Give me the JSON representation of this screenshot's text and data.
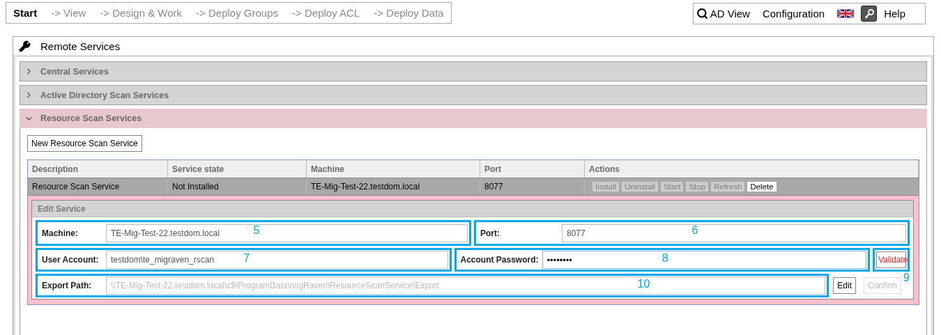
{
  "nav": {
    "steps": [
      {
        "label": "Start",
        "selected": true
      },
      {
        "label": "-> View",
        "selected": false
      },
      {
        "label": "-> Design & Work",
        "selected": false
      },
      {
        "label": "-> Deploy Groups",
        "selected": false
      },
      {
        "label": "-> Deploy ACL",
        "selected": false
      },
      {
        "label": "-> Deploy Data",
        "selected": false
      }
    ],
    "menu": [
      {
        "kind": "search-link",
        "label": "AD View"
      },
      {
        "kind": "link",
        "label": "Configuration"
      },
      {
        "kind": "flag"
      },
      {
        "kind": "key"
      },
      {
        "kind": "link",
        "label": "Help"
      }
    ]
  },
  "panel": {
    "title": "Remote Services",
    "sections": [
      {
        "title": "Central Services",
        "expanded": false
      },
      {
        "title": "Active Directory Scan Services",
        "expanded": false
      },
      {
        "title": "Resource Scan Services",
        "expanded": true
      }
    ],
    "new_button": "New Resource Scan Service",
    "table": {
      "columns": [
        "Description",
        "Service state",
        "Machine",
        "Port",
        "Actions"
      ],
      "rows": [
        {
          "selected": true,
          "cells": [
            "Resource Scan Service",
            "Not Installed",
            "TE-Mig-Test-22.testdom.local",
            "8077"
          ],
          "actions": [
            {
              "label": "Install",
              "disabled": true
            },
            {
              "label": "Uninstall",
              "disabled": true
            },
            {
              "label": "Start",
              "disabled": true
            },
            {
              "label": "Stop",
              "disabled": true
            },
            {
              "label": "Refresh",
              "disabled": true
            },
            {
              "label": "Delete",
              "disabled": false
            }
          ]
        }
      ]
    },
    "edit_service": {
      "title": "Edit Service",
      "rows": [
        {
          "fields": [
            {
              "label": "Machine:",
              "value": "TE-Mig-Test-22.testdom.local",
              "disabled": false,
              "annotation": "5"
            },
            {
              "label": "Port:",
              "value": "8077",
              "disabled": false,
              "annotation": "6"
            }
          ]
        },
        {
          "fields": [
            {
              "label": "User Account:",
              "value": "testdom\\te_migraven_rscan",
              "disabled": false,
              "annotation": "7"
            },
            {
              "label": "Account Password:",
              "value": "••••••••",
              "disabled": false,
              "annotation": "8"
            }
          ],
          "button": {
            "label": "Validate",
            "annotation": "9"
          }
        },
        {
          "fields": [
            {
              "label": "Export Path:",
              "value": "\\\\TE-Mig-Test-22.testdom.local\\c$\\ProgramData\\migRaven\\ResourceScanService\\Export",
              "disabled": true,
              "annotation": "10"
            }
          ],
          "buttons": [
            {
              "label": "Edit",
              "disabled": false
            },
            {
              "label": "Confirm",
              "disabled": true
            }
          ]
        }
      ]
    }
  }
}
